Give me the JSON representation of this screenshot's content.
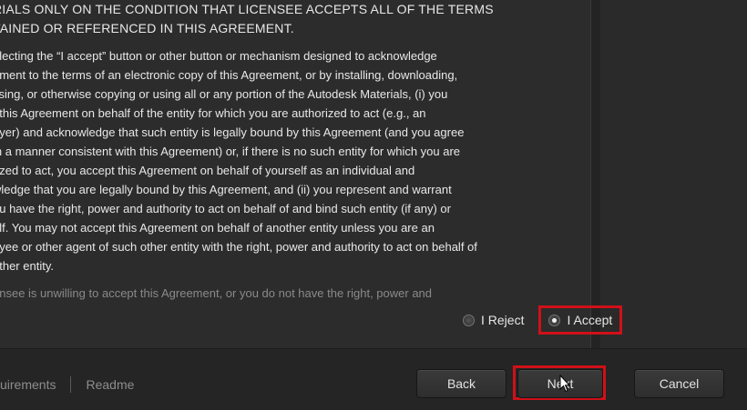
{
  "license": {
    "lines_caps": [
      "RIALS ONLY ON THE CONDITION THAT LICENSEE ACCEPTS ALL OF THE TERMS",
      "TAINED OR REFERENCED IN THIS AGREEMENT."
    ],
    "lines": [
      "electing the “I accept” button or other button or mechanism designed to acknowledge",
      "ement to the terms of an electronic copy of this Agreement, or by installing, downloading,",
      "ssing, or otherwise copying or using all or any portion of the Autodesk Materials, (i) you",
      "t this Agreement on behalf of the entity for which you are authorized to act (e.g., an",
      "oyer) and acknowledge that such entity is legally bound by this Agreement (and you agree",
      "in a manner consistent with this Agreement) or, if there is no such entity for which you are",
      "rized to act, you accept this Agreement on behalf of yourself as an individual and",
      "wledge that you are legally bound by this Agreement, and (ii) you represent and warrant",
      "ou have the right, power and authority to act on behalf of and bind such entity (if any) or",
      "elf.  You may not accept this Agreement on behalf of another entity unless you are an",
      "oyee or other agent of such other entity with the right, power and authority to act on behalf of",
      "other entity."
    ],
    "faded_line": "ensee is unwilling to accept this Agreement, or you do not have the right, power and"
  },
  "radio": {
    "reject_label": "I Reject",
    "accept_label": "I Accept",
    "selected": "accept"
  },
  "footer": {
    "link_requirements": "uirements",
    "link_readme": "Readme",
    "back_label": "Back",
    "next_label": "Next",
    "cancel_label": "Cancel"
  },
  "colors": {
    "highlight": "#d01018",
    "background": "#2c2c2c",
    "footer": "#252525"
  }
}
